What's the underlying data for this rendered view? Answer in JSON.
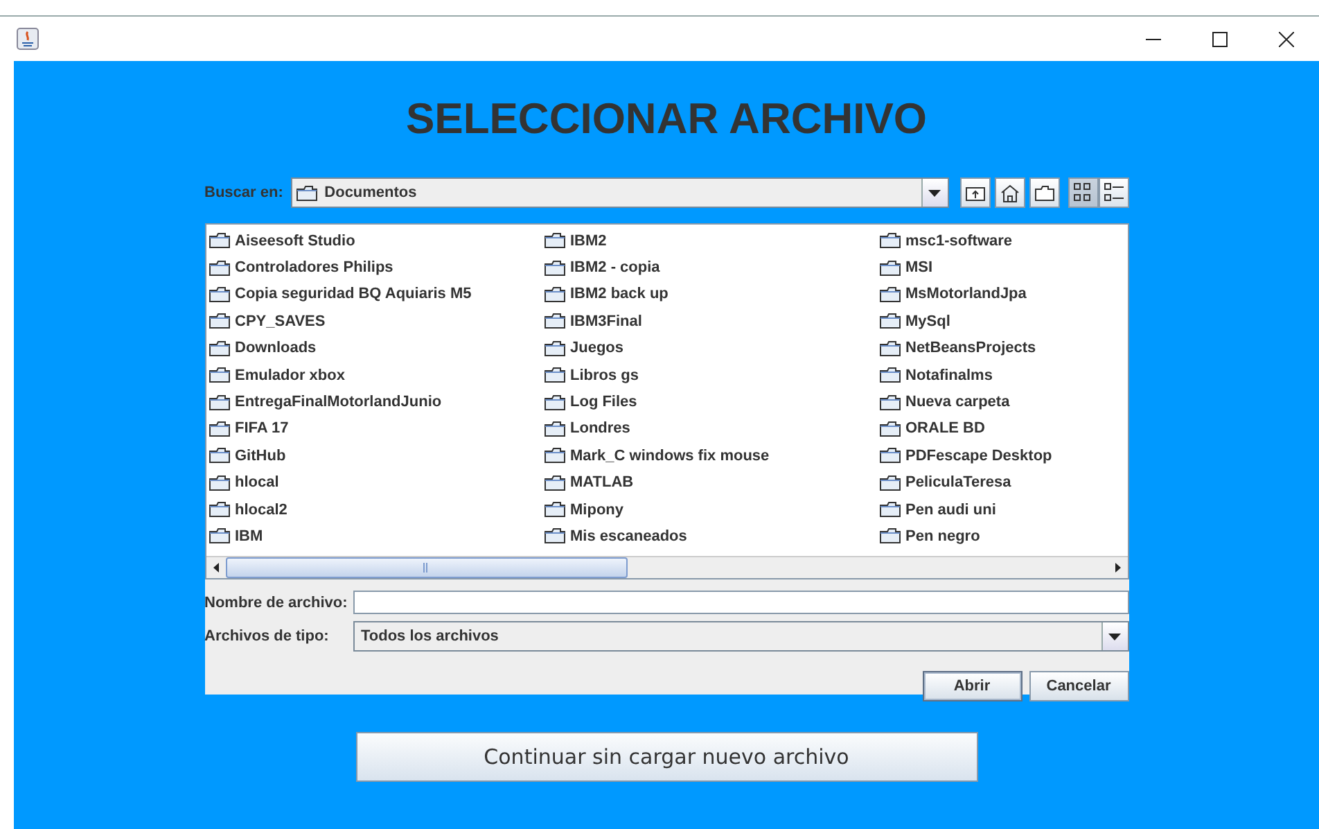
{
  "heading": "SELECCIONAR ARCHIVO",
  "look_in": {
    "label": "Buscar en:",
    "value": "Documentos"
  },
  "toolbar": [
    {
      "kind": "up"
    },
    {
      "kind": "home"
    },
    {
      "kind": "new-folder"
    },
    {
      "kind": "list",
      "selected": true
    },
    {
      "kind": "details",
      "selected": false
    }
  ],
  "files": [
    {
      "name": "Aiseesoft Studio"
    },
    {
      "name": "Controladores Philips"
    },
    {
      "name": "Copia seguridad BQ Aquiaris M5"
    },
    {
      "name": "CPY_SAVES"
    },
    {
      "name": "Downloads"
    },
    {
      "name": "Emulador xbox"
    },
    {
      "name": "EntregaFinalMotorlandJunio"
    },
    {
      "name": "FIFA 17"
    },
    {
      "name": "GitHub"
    },
    {
      "name": "hlocal"
    },
    {
      "name": "hlocal2"
    },
    {
      "name": "IBM"
    },
    {
      "name": "IBM2"
    },
    {
      "name": "IBM2 - copia"
    },
    {
      "name": "IBM2 back up"
    },
    {
      "name": "IBM3Final"
    },
    {
      "name": "Juegos"
    },
    {
      "name": "Libros gs"
    },
    {
      "name": "Log Files"
    },
    {
      "name": "Londres"
    },
    {
      "name": "Mark_C windows fix mouse"
    },
    {
      "name": "MATLAB"
    },
    {
      "name": "Mipony"
    },
    {
      "name": "Mis escaneados"
    },
    {
      "name": "msc1-software"
    },
    {
      "name": "MSI"
    },
    {
      "name": "MsMotorlandJpa"
    },
    {
      "name": "MySql"
    },
    {
      "name": "NetBeansProjects"
    },
    {
      "name": "Notafinalms"
    },
    {
      "name": "Nueva carpeta"
    },
    {
      "name": "ORALE BD"
    },
    {
      "name": "PDFescape Desktop"
    },
    {
      "name": "PeliculaTeresa"
    },
    {
      "name": "Pen audi uni"
    },
    {
      "name": "Pen negro"
    }
  ],
  "file_name": {
    "label": "Nombre de archivo:"
  },
  "file_type": {
    "label": "Archivos de tipo:",
    "value": "Todos los archivos"
  },
  "buttons": [
    {
      "label": "Abrir",
      "default": true
    },
    {
      "label": "Cancelar",
      "default": false
    }
  ],
  "continue_button": "Continuar sin cargar nuevo archivo"
}
